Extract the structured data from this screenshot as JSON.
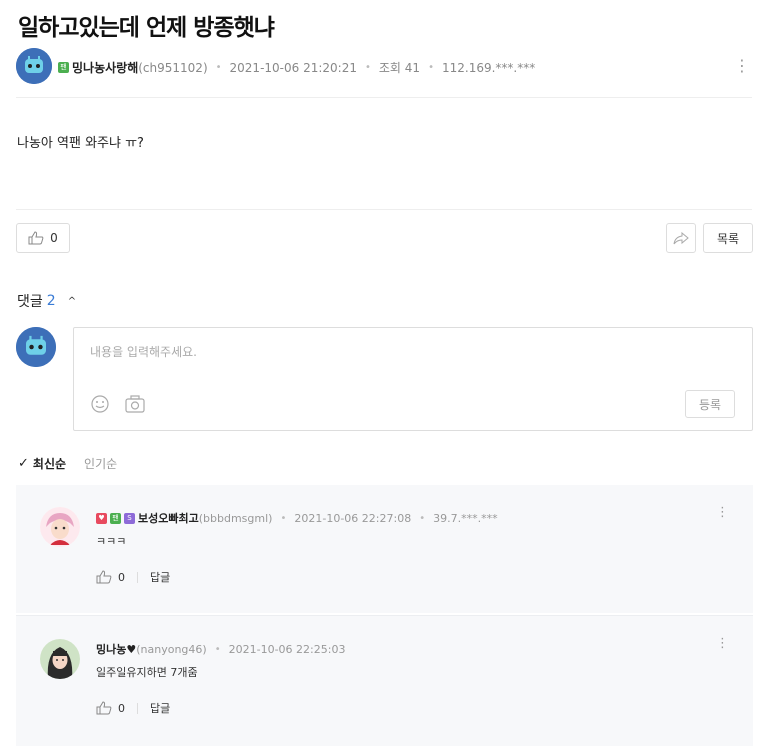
{
  "post": {
    "title": "일하고있는데 언제 방종햇냐",
    "author": "밍나농사랑해",
    "author_id": "(ch951102)",
    "datetime": "2021-10-06 21:20:21",
    "views_label": "조회 41",
    "ip": "112.169.***.***",
    "body": "나농아 역팬 와주냐 ㅠ?",
    "likes": "0",
    "list_label": "목록"
  },
  "comments_section": {
    "label": "댓글",
    "count": "2",
    "placeholder": "내용을 입력해주세요.",
    "submit_label": "등록",
    "sort_latest": "최신순",
    "sort_popular": "인기순"
  },
  "comments": [
    {
      "nick": "보성오빠최고",
      "user_id": "(bbbdmsgml)",
      "datetime": "2021-10-06 22:27:08",
      "ip": "39.7.***.***",
      "text": "ㅋㅋㅋ",
      "likes": "0",
      "reply_label": "답글"
    },
    {
      "nick": "밍나농♥",
      "user_id": "(nanyong46)",
      "datetime": "2021-10-06 22:25:03",
      "text": "일주일유지하면 7개줌",
      "likes": "0",
      "reply_label": "답글"
    }
  ],
  "colors": {
    "accent": "#3a7bd5",
    "badge_green": "#4caf50",
    "badge_red": "#e84a5f",
    "badge_purple": "#8e6bd8"
  },
  "icons": [
    "thumbs-up-icon",
    "share-icon",
    "kebab-icon",
    "emoji-icon",
    "camera-icon",
    "check-icon",
    "chevron-up-icon"
  ]
}
